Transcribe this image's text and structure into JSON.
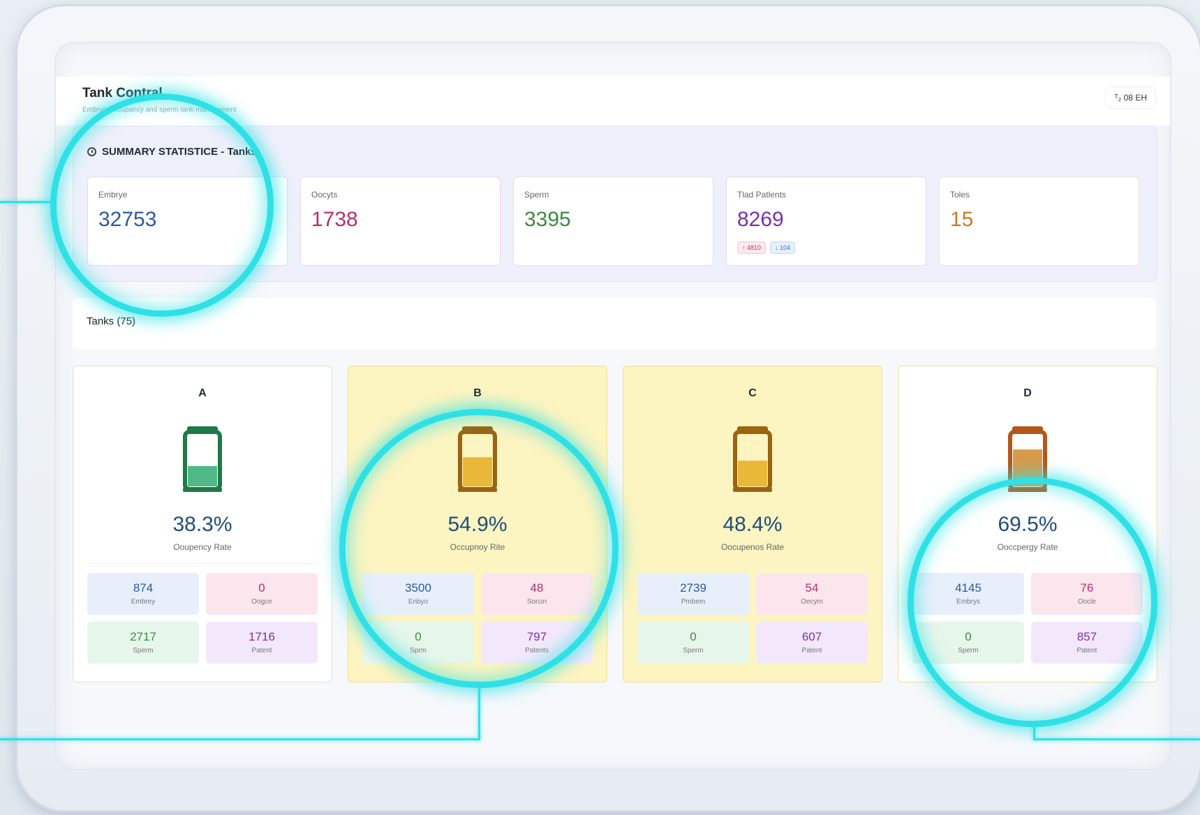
{
  "app": {
    "title": "Tank Contral",
    "subtitle": "Embryo, occupancy and sperm tank management",
    "lang_label": "ᵀ₂ 08 EH"
  },
  "summary": {
    "title": "SUMMARY STATISTICE - Tanks",
    "stats": [
      {
        "label": "Embrye",
        "value": "32753",
        "color": "#2a5a9e"
      },
      {
        "label": "Oocyts",
        "value": "1738",
        "color": "#b8306a"
      },
      {
        "label": "Sperm",
        "value": "3395",
        "color": "#3c8a3c"
      },
      {
        "label": "Tlad Patlents",
        "value": "8269",
        "color": "#7a2fb0",
        "chips": [
          "↑ 4810",
          "↓ 104"
        ]
      },
      {
        "label": "Toles",
        "value": "15",
        "color": "#cc7a1e"
      }
    ]
  },
  "tanks_heading": "Tanks (75)",
  "tanks": [
    {
      "name": "A",
      "pct": "38.3%",
      "fill": 0.383,
      "caption": "Ooupency Rate",
      "embryos": "874",
      "embryos_label": "Embrey",
      "oocytes": "0",
      "oocytes_label": "Oogce",
      "sperm": "2717",
      "sperm_label": "Sperm",
      "patients": "1716",
      "patients_label": "Patent"
    },
    {
      "name": "B",
      "pct": "54.9%",
      "fill": 0.549,
      "caption": "Occupnoy Rite",
      "embryos": "3500",
      "embryos_label": "Enbyo",
      "oocytes": "48",
      "oocytes_label": "Sorcin",
      "sperm": "0",
      "sperm_label": "Sprm",
      "patients": "797",
      "patients_label": "Patents"
    },
    {
      "name": "C",
      "pct": "48.4%",
      "fill": 0.484,
      "caption": "Oocupenos Rate",
      "embryos": "2739",
      "embryos_label": "Pmbem",
      "oocytes": "54",
      "oocytes_label": "Oecym",
      "sperm": "0",
      "sperm_label": "Sperm",
      "patients": "607",
      "patients_label": "Patent"
    },
    {
      "name": "D",
      "pct": "69.5%",
      "fill": 0.695,
      "caption": "Ooccpergy Rate",
      "embryos": "4145",
      "embryos_label": "Embrys",
      "oocytes": "76",
      "oocytes_label": "Oocle",
      "sperm": "0",
      "sperm_label": "Sperm",
      "patients": "857",
      "patients_label": "Patent"
    }
  ],
  "colors": {
    "tank_green": "#1e7a46",
    "tank_gold": "#9a6410",
    "accent_cyan": "#2ee1e6"
  }
}
